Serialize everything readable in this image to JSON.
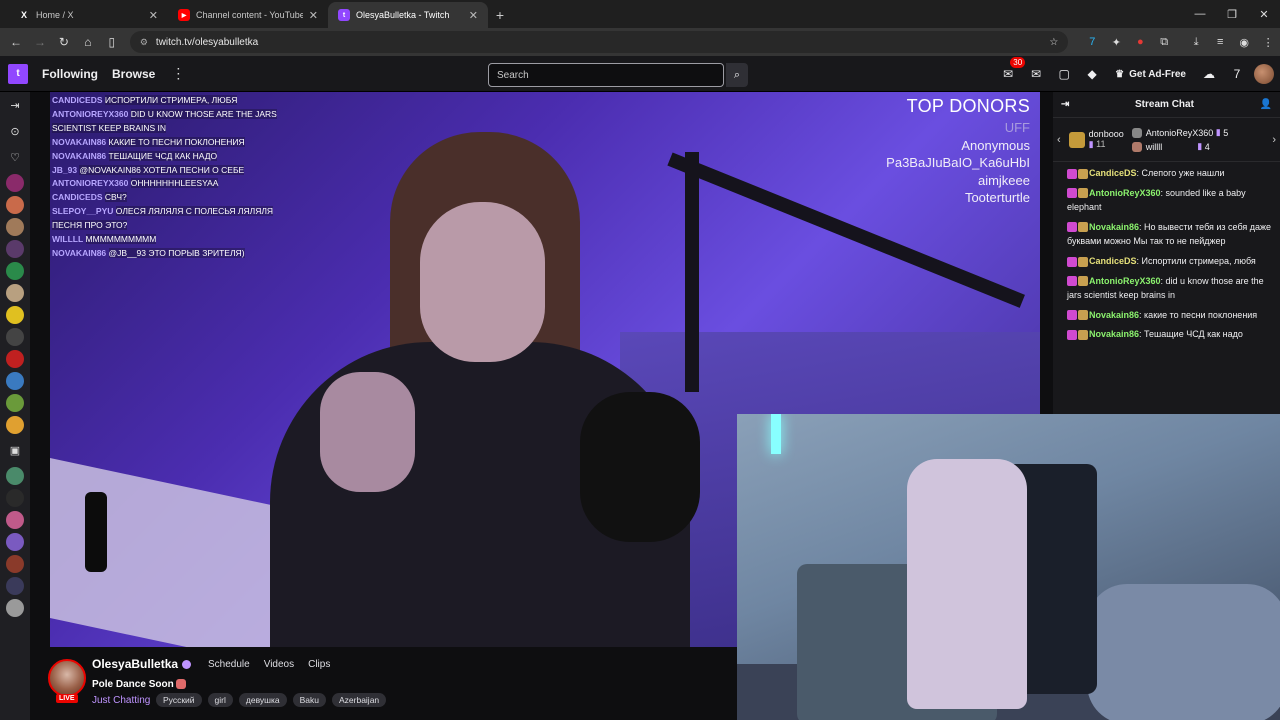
{
  "browser": {
    "tabs": [
      {
        "title": "Home / X",
        "icon": "x-logo-icon",
        "color": "#ffffff"
      },
      {
        "title": "Channel content - YouTube Stu",
        "icon": "youtube-studio-icon",
        "color": "#ff0000"
      },
      {
        "title": "OlesyaBulletka - Twitch",
        "icon": "twitch-icon",
        "color": "#9147ff",
        "active": true
      }
    ],
    "url": "twitch.tv/olesyabulletka"
  },
  "twitch_nav": {
    "following": "Following",
    "browse": "Browse",
    "search_placeholder": "Search",
    "notifications_count": "30",
    "get_ad_free": "Get Ad-Free"
  },
  "overlay_chat": [
    {
      "user": "CANDICEDS",
      "msg": "ИСПОРТИЛИ СТРИМЕРА, ЛЮБЯ"
    },
    {
      "user": "ANTONIOREYX360",
      "msg": "DID U KNOW THOSE ARE THE JARS SCIENTIST KEEP BRAINS IN"
    },
    {
      "user": "NOVAKAIN86",
      "msg": "КАКИЕ ТО ПЕСНИ ПОКЛОНЕНИЯ"
    },
    {
      "user": "NOVAKAIN86",
      "msg": "ТЕШАЩИЕ ЧСД КАК НАДО"
    },
    {
      "user": "JB_93",
      "msg": "@NOVAKAIN86 ХОТЕЛА ПЕСНИ О СЕБЕ"
    },
    {
      "user": "ANTONIOREYX360",
      "msg": "OHHHHHHHLEESYAA"
    },
    {
      "user": "CANDICEDS",
      "msg": "СВЧ?"
    },
    {
      "user": "SLEPOY__PYU",
      "msg": "ОЛЕСЯ ЛЯЛЯЛЯ С ПОЛЕСЬЯ ЛЯЛЯЛЯ ПЕСНЯ ПРО ЭТО?"
    },
    {
      "user": "WILLLL",
      "msg": "ММММММММММ"
    },
    {
      "user": "NOVAKAIN86",
      "msg": "@JB__93 ЭТО ПОРЫВ ЗРИТЕЛЯ)"
    }
  ],
  "top_donors": {
    "heading": "TOP DONORS",
    "names": [
      "UFF",
      "Anonymous",
      "Pa3BaJIuBaIO_Ka6uHbI",
      "aimjkeee",
      "Tooterturtle"
    ]
  },
  "channel": {
    "name": "OlesyaBulletka",
    "tabs": [
      "Schedule",
      "Videos",
      "Clips"
    ],
    "stream_title": "Pole Dance Soon",
    "live_label": "LIVE",
    "category": "Just Chatting",
    "tags": [
      "Русский",
      "girl",
      "девушка",
      "Baku",
      "Azerbaijan"
    ]
  },
  "stream_chat": {
    "title": "Stream Chat",
    "gifters": [
      {
        "name": "donbooo",
        "count": "11"
      },
      {
        "name": "AntonioReyX360",
        "count": "5"
      },
      {
        "name": "willll",
        "count": "4"
      }
    ],
    "messages": [
      {
        "user": "CandiceDS",
        "color": "#e5e07a",
        "text": "Слепого уже нашли"
      },
      {
        "user": "AntonioReyX360",
        "color": "#8bf26e",
        "text": "sounded like a baby elephant"
      },
      {
        "user": "Novakain86",
        "color": "#8bf26e",
        "text": "Но вывести тебя из себя даже буквами можно Мы так то не пейджер"
      },
      {
        "user": "CandiceDS",
        "color": "#e5e07a",
        "text": "Испортили стримера, любя"
      },
      {
        "user": "AntonioReyX360",
        "color": "#8bf26e",
        "text": "did u know those are the jars scientist keep brains in"
      },
      {
        "user": "Novakain86",
        "color": "#8bf26e",
        "text": "какие то песни поклонения"
      },
      {
        "user": "Novakain86",
        "color": "#8bf26e",
        "text": "Тешащие ЧСД как надо"
      }
    ]
  }
}
